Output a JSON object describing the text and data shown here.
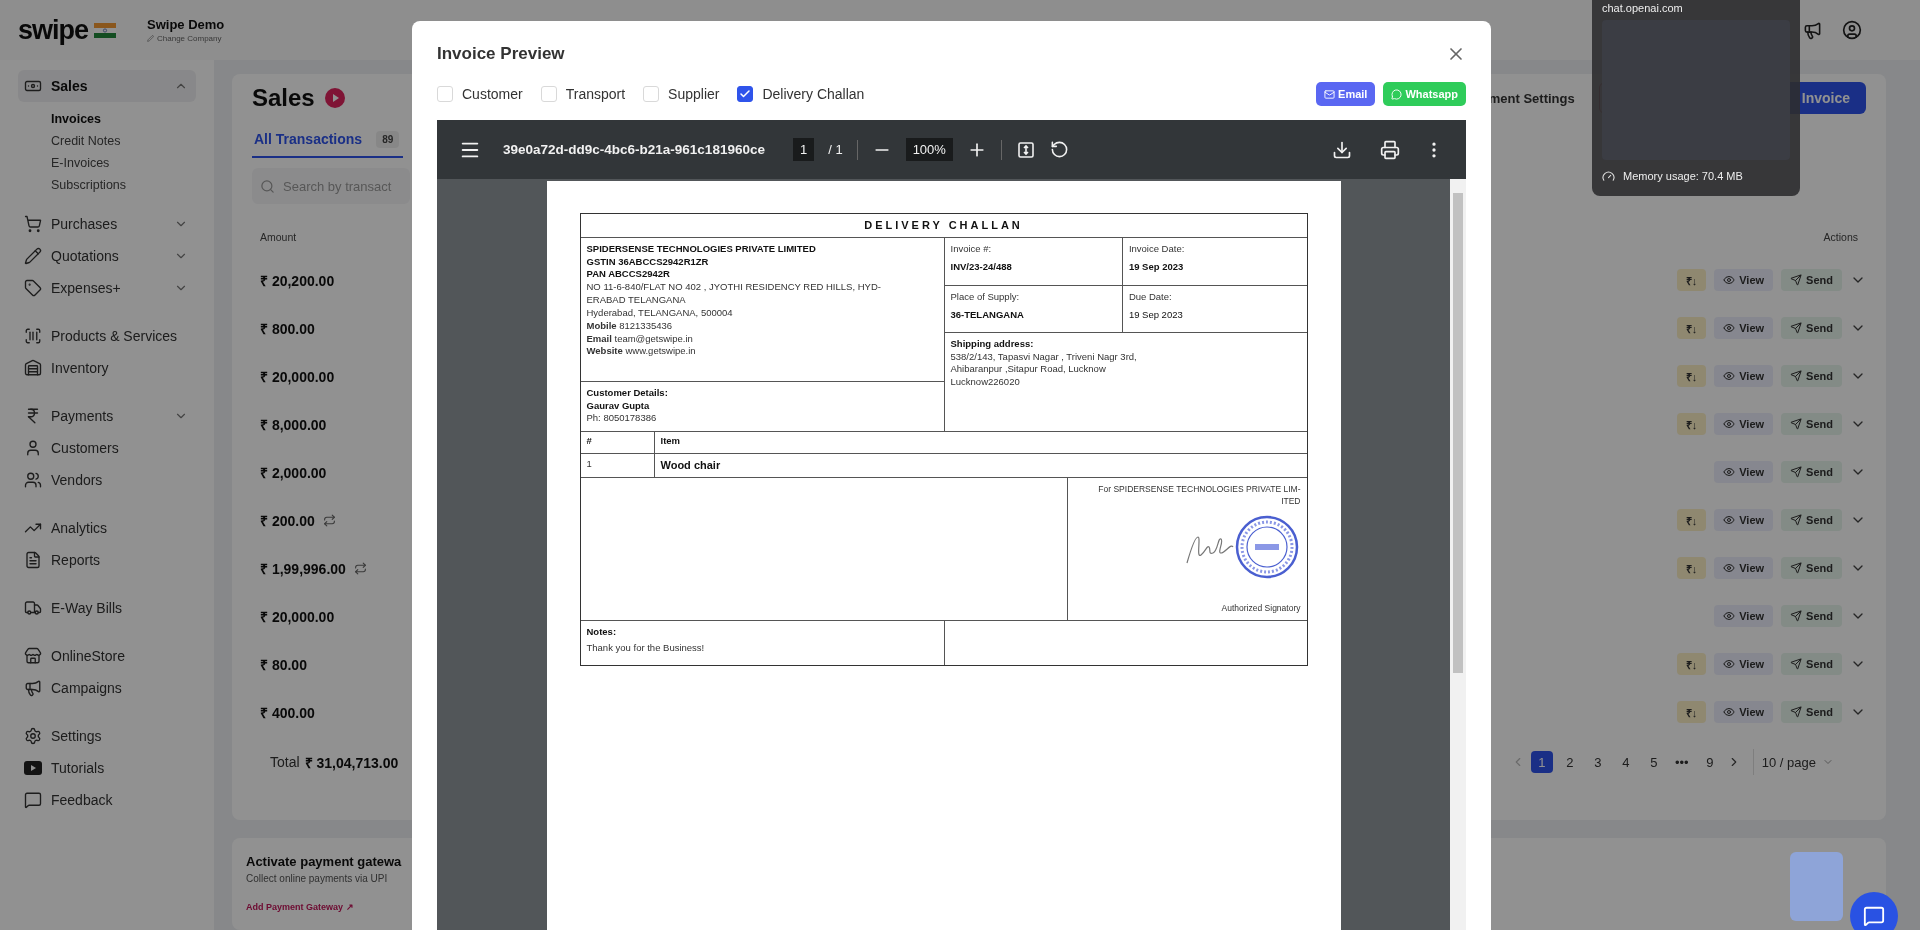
{
  "header": {
    "logo": "swipe",
    "company": "Swipe Demo",
    "change_company": "Change Company"
  },
  "sidebar": {
    "groups": [
      {
        "items": [
          {
            "label": "Sales",
            "kind": "menu",
            "expanded": true,
            "selected": true,
            "children": [
              {
                "label": "Invoices",
                "selected": true
              },
              {
                "label": "Credit Notes",
                "selected": false
              },
              {
                "label": "E-Invoices",
                "selected": false
              },
              {
                "label": "Subscriptions",
                "selected": false
              }
            ]
          },
          {
            "label": "Purchases",
            "kind": "menu",
            "expanded": false,
            "selected": false
          },
          {
            "label": "Quotations",
            "kind": "menu",
            "expanded": false,
            "selected": false
          },
          {
            "label": "Expenses+",
            "kind": "menu",
            "expanded": false,
            "selected": false
          }
        ]
      },
      {
        "items": [
          {
            "label": "Products & Services",
            "kind": "link",
            "selected": false
          },
          {
            "label": "Inventory",
            "kind": "link",
            "selected": false
          }
        ]
      },
      {
        "items": [
          {
            "label": "Payments",
            "kind": "menu",
            "expanded": false,
            "selected": false
          },
          {
            "label": "Customers",
            "kind": "link",
            "selected": false
          },
          {
            "label": "Vendors",
            "kind": "link",
            "selected": false
          }
        ]
      },
      {
        "items": [
          {
            "label": "Analytics",
            "kind": "link",
            "selected": false
          },
          {
            "label": "Reports",
            "kind": "link",
            "selected": false
          }
        ]
      },
      {
        "items": [
          {
            "label": "E-Way Bills",
            "kind": "link",
            "selected": false
          }
        ]
      },
      {
        "items": [
          {
            "label": "OnlineStore",
            "kind": "link",
            "selected": false
          },
          {
            "label": "Campaigns",
            "kind": "link",
            "selected": false
          }
        ]
      },
      {
        "items": [
          {
            "label": "Settings",
            "kind": "link",
            "selected": false
          },
          {
            "label": "Tutorials",
            "kind": "link",
            "selected": false
          },
          {
            "label": "Feedback",
            "kind": "link",
            "selected": false
          }
        ]
      }
    ]
  },
  "main": {
    "title": "Sales",
    "tabs": [
      {
        "label": "All Transactions",
        "count": "89",
        "selected": true
      }
    ],
    "search": {
      "placeholder": "Search by transact"
    },
    "settings_link": "ment Settings",
    "create_button": "Invoice",
    "table": {
      "columns": [
        "Amount",
        "Actions"
      ],
      "rows": [
        {
          "amount": "₹ 20,200.00",
          "recurring": false,
          "receive": "₹↓",
          "actions": [
            "View",
            "Send"
          ]
        },
        {
          "amount": "₹ 800.00",
          "recurring": false,
          "receive": "₹↓",
          "actions": [
            "View",
            "Send"
          ]
        },
        {
          "amount": "₹ 20,000.00",
          "recurring": false,
          "receive": "₹↓",
          "actions": [
            "View",
            "Send"
          ]
        },
        {
          "amount": "₹ 8,000.00",
          "recurring": false,
          "receive": "₹↓",
          "actions": [
            "View",
            "Send"
          ]
        },
        {
          "amount": "₹ 2,000.00",
          "recurring": false,
          "actions": [
            "View",
            "Send"
          ]
        },
        {
          "amount": "₹ 200.00",
          "recurring": true,
          "receive": "₹↓",
          "actions": [
            "View",
            "Send"
          ]
        },
        {
          "amount": "₹ 1,99,996.00",
          "recurring": true,
          "receive": "₹↓",
          "actions": [
            "View",
            "Send"
          ]
        },
        {
          "amount": "₹ 20,000.00",
          "recurring": false,
          "actions": [
            "View",
            "Send"
          ]
        },
        {
          "amount": "₹ 80.00",
          "recurring": false,
          "receive": "₹↓",
          "actions": [
            "View",
            "Send"
          ]
        },
        {
          "amount": "₹ 400.00",
          "recurring": false,
          "receive": "₹↓",
          "actions": [
            "View",
            "Send"
          ]
        }
      ]
    },
    "total_label": "Total",
    "total_value": "₹ 31,04,713.00",
    "pagination": {
      "pages": [
        {
          "label": "1",
          "selected": true
        },
        {
          "label": "2",
          "selected": false
        },
        {
          "label": "3",
          "selected": false
        },
        {
          "label": "4",
          "selected": false
        },
        {
          "label": "5",
          "selected": false
        },
        {
          "label": "•••",
          "selected": false
        },
        {
          "label": "9",
          "selected": false
        }
      ],
      "page_size": "10 / page"
    }
  },
  "payment_card": {
    "title": "Activate payment gatewa",
    "text": "Collect online payments via UPI",
    "link": "Add Payment Gateway ↗"
  },
  "tab_preview": {
    "site": "chat.openai.com",
    "memory": "Memory usage: 70.4 MB"
  },
  "modal": {
    "title": "Invoice Preview",
    "options": [
      {
        "label": "Customer",
        "checked": false
      },
      {
        "label": "Transport",
        "checked": false
      },
      {
        "label": "Supplier",
        "checked": false
      },
      {
        "label": "Delivery Challan",
        "checked": true
      }
    ],
    "share_buttons": [
      {
        "label": "Email",
        "kind": "email"
      },
      {
        "label": "Whatsapp",
        "kind": "whatsapp"
      }
    ],
    "viewer": {
      "filename": "39e0a72d-dd9c-4bc6-b21a-961c181960ce",
      "page": "1",
      "page_total": "/ 1",
      "zoom": "100%"
    },
    "document": {
      "title": "DELIVERY CHALLAN",
      "company": {
        "name": "SPIDERSENSE TECHNOLOGIES PRIVATE LIMITED",
        "gstin": "GSTIN 36ABCCS2942R1ZR",
        "pan": "PAN ABCCS2942R",
        "address": [
          "NO 11-6-840/FLAT NO 402 , JYOTHI RESIDENCY RED HILLS, HYD-",
          "ERABAD TELANGANA"
        ],
        "city": "Hyderabad, TELANGANA, 500004",
        "contacts": [
          "**Mobile** 8121335436",
          "**Email** team@getswipe.in",
          "**Website** www.getswipe.in"
        ]
      },
      "meta": [
        {
          "label": "Invoice #:",
          "value": "INV/23-24/488",
          "strong": true
        },
        {
          "label": "Invoice Date:",
          "value": "19 Sep 2023",
          "strong": true
        },
        {
          "label": "Place of Supply:",
          "value": "36-TELANGANA",
          "strong": true
        },
        {
          "label": "Due Date:",
          "value": "19 Sep 2023",
          "strong": false
        }
      ],
      "shipping": {
        "label": "Shipping address:",
        "lines": [
          "538/2/143, Tapasvi Nagar , Triveni Nagr 3rd,",
          "Ahibaranpur ,Sitapur Road, Lucknow",
          "Lucknow226020"
        ]
      },
      "customer": {
        "label": "Customer Details:",
        "name": "Gaurav Gupta",
        "phone": "Ph: 8050178386"
      },
      "items": {
        "columns": [
          "#",
          "Item"
        ],
        "rows": [
          [
            "1",
            "Wood chair"
          ]
        ]
      },
      "signature": {
        "for": [
          "For SPIDERSENSE TECHNOLOGIES PRIVATE LIM-",
          "ITED"
        ],
        "label": "Authorized Signatory"
      },
      "notes": {
        "label": "Notes:",
        "text": "Thank you for the Business!"
      }
    }
  }
}
